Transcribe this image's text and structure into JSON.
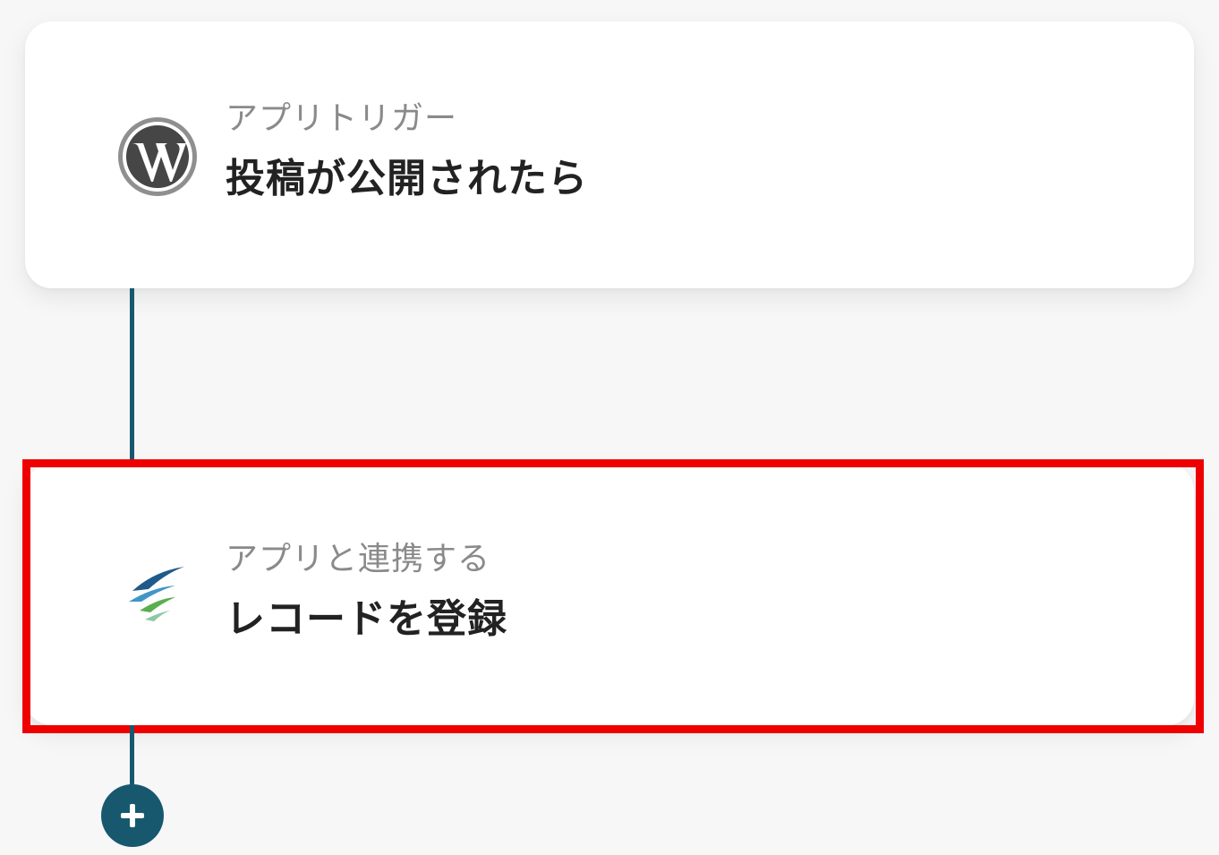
{
  "flow": {
    "steps": [
      {
        "subtitle": "アプリトリガー",
        "title": "投稿が公開されたら",
        "icon": "wordpress-icon"
      },
      {
        "subtitle": "アプリと連携する",
        "title": "レコードを登録",
        "icon": "kintone-icon"
      }
    ],
    "add_icon": "plus-icon"
  },
  "colors": {
    "connector": "#17586f",
    "highlight": "#ee0000",
    "card_background": "#ffffff",
    "page_background": "#f7f7f7"
  }
}
